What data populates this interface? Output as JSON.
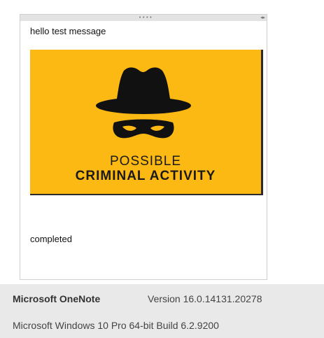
{
  "note": {
    "drag_handle_icon": "grip-dots-icon",
    "resize_icon": "left-right-arrows-icon",
    "line1": "hello test message",
    "image": {
      "background_color": "#fdb913",
      "icon": "masked-spy-icon",
      "caption_line1": "POSSIBLE",
      "caption_line2": "CRIMINAL ACTIVITY"
    },
    "line2": "completed"
  },
  "footer": {
    "product_name": "Microsoft OneNote",
    "version": "Version 16.0.14131.20278",
    "os_info": "Microsoft Windows 10 Pro 64-bit Build 6.2.9200"
  }
}
